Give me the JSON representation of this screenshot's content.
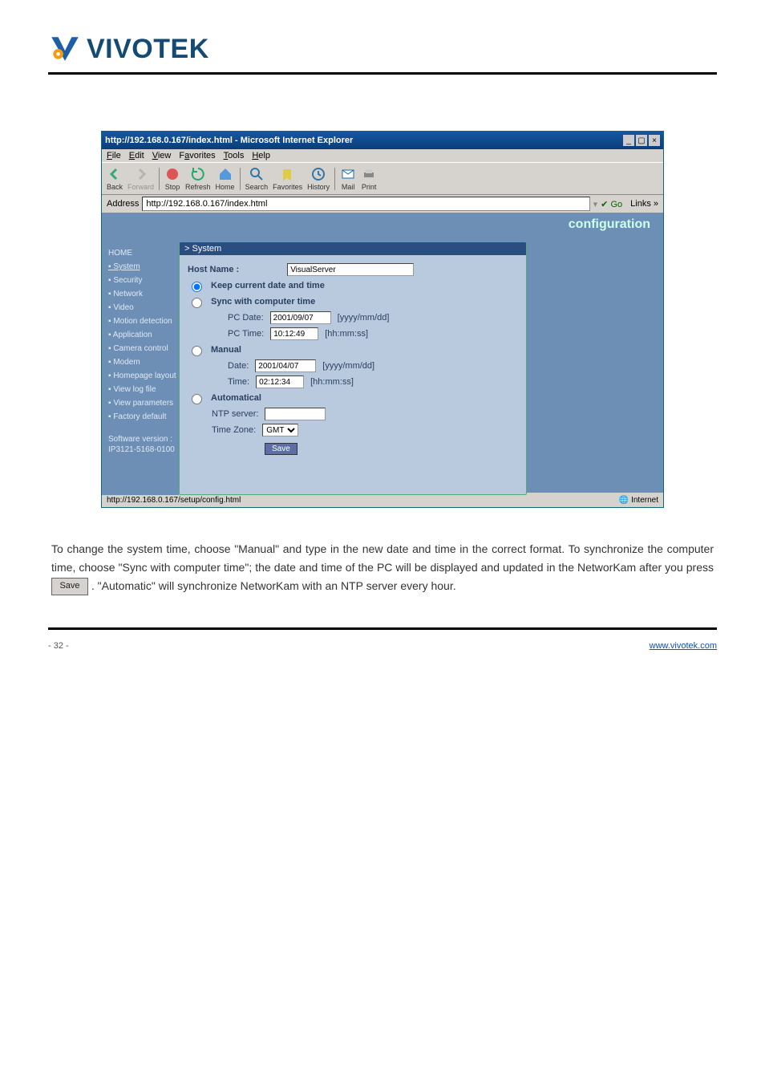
{
  "logo": {
    "text": "VIVOTEK"
  },
  "browser": {
    "title": "http://192.168.0.167/index.html - Microsoft Internet Explorer",
    "menu": [
      "File",
      "Edit",
      "View",
      "Favorites",
      "Tools",
      "Help"
    ],
    "btns": {
      "back": "Back",
      "forward": "Forward",
      "stop": "Stop",
      "refresh": "Refresh",
      "home": "Home",
      "search": "Search",
      "favorites": "Favorites",
      "history": "History",
      "mail": "Mail",
      "print": "Print"
    },
    "addr_label": "Address",
    "addr_value": "http://192.168.0.167/index.html",
    "go": "Go",
    "links": "Links »",
    "status_left": "http://192.168.0.167/setup/config.html",
    "status_right": "Internet"
  },
  "cfg": {
    "header": "configuration",
    "nav": {
      "home": "HOME",
      "items": [
        "System",
        "Security",
        "Network",
        "Video",
        "Motion detection",
        "Application",
        "Camera control",
        "Modem",
        "Homepage layout",
        "View log file",
        "View parameters",
        "Factory default"
      ],
      "sw1": "Software version :",
      "sw2": "IP3121-5168-0100"
    },
    "panel": {
      "title": "> System",
      "host_label": "Host Name :",
      "host_value": "VisualServer",
      "r1": "Keep current date and time",
      "r2": "Sync with computer time",
      "pc_date_l": "PC Date:",
      "pc_date_v": "2001/09/07",
      "pc_date_h": "[yyyy/mm/dd]",
      "pc_time_l": "PC Time:",
      "pc_time_v": "10:12:49",
      "pc_time_h": "[hh:mm:ss]",
      "r3": "Manual",
      "m_date_l": "Date:",
      "m_date_v": "2001/04/07",
      "m_date_h": "[yyyy/mm/dd]",
      "m_time_l": "Time:",
      "m_time_v": "02:12:34",
      "m_time_h": "[hh:mm:ss]",
      "r4": "Automatical",
      "ntp_l": "NTP server:",
      "ntp_v": "",
      "tz_l": "Time Zone:",
      "tz_v": "GMT",
      "save": "Save"
    }
  },
  "copy": {
    "p1a": "To change the system time, choose \"Manual\" and type in the new date and time in the correct format. To synchronize the computer time, choose \"Sync with computer time\"; the date and time of the PC will be displayed and updated in the NetworKam after you press ",
    "save_btn": "Save",
    "p1b": ". \"Automatic\" will synchronize NetworKam with an NTP server every hour."
  },
  "footer": {
    "left": "- 32 -",
    "right": "www.vivotek.com"
  }
}
